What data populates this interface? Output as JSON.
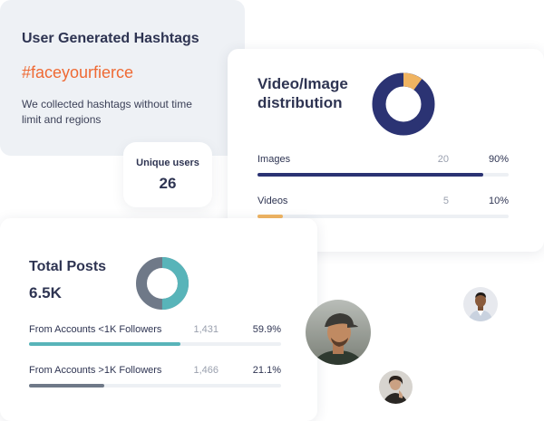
{
  "hashtag": {
    "title": "User Generated Hashtags",
    "tag": "#faceyourfierce",
    "description": "We collected hashtags without time limit and regions"
  },
  "unique_users": {
    "label": "Unique users",
    "value": "26"
  },
  "distribution": {
    "title": "Video/Image distribution",
    "rows": [
      {
        "label": "Images",
        "count": "20",
        "percent": "90%",
        "fraction": 0.9,
        "color": "#2b3373"
      },
      {
        "label": "Videos",
        "count": "5",
        "percent": "10%",
        "fraction": 0.1,
        "color": "#f0b461"
      }
    ],
    "donut_colors": {
      "primary": "#2b3373",
      "secondary": "#f0b461"
    }
  },
  "total_posts": {
    "title": "Total Posts",
    "value": "6.5K",
    "rows": [
      {
        "label": "From Accounts <1K Followers",
        "count": "1,431",
        "percent": "59.9%",
        "fraction": 0.599,
        "color": "#58b4b9"
      },
      {
        "label": "From Accounts >1K Followers",
        "count": "1,466",
        "percent": "21.1%",
        "fraction": 0.3,
        "color": "#6f7988"
      }
    ],
    "donut_colors": {
      "primary": "#58b4b9",
      "secondary": "#6f7988"
    },
    "donut_fraction": 0.5
  },
  "avatars": [
    {
      "name": "avatar-man-cap"
    },
    {
      "name": "avatar-man-suit"
    },
    {
      "name": "avatar-woman"
    }
  ]
}
